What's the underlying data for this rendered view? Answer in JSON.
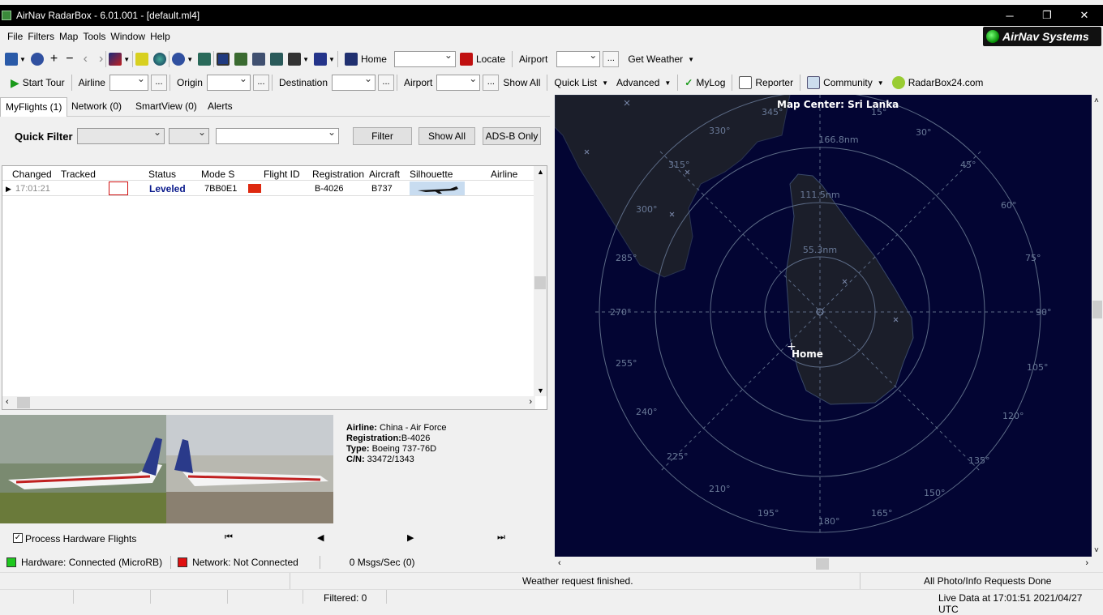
{
  "window": {
    "title": "AirNav RadarBox - 6.01.001 - [default.ml4]",
    "min": "─",
    "max": "❐",
    "close": "✕"
  },
  "menu": [
    "File",
    "Filters",
    "Map",
    "Tools",
    "Window",
    "Help"
  ],
  "brand": "AirNav Systems",
  "toolbar1": {
    "home": "Home",
    "locate": "Locate",
    "airport": "Airport",
    "get_weather": "Get Weather"
  },
  "toolbar2": {
    "start_tour": "Start Tour",
    "airline": "Airline",
    "origin": "Origin",
    "destination": "Destination",
    "airport": "Airport",
    "show_all": "Show All",
    "quick_list": "Quick List",
    "advanced": "Advanced",
    "mylog": "MyLog",
    "reporter": "Reporter",
    "community": "Community",
    "radarbox24": "RadarBox24.com",
    "ellipsis": "..."
  },
  "tabs": [
    "MyFlights (1)",
    "Network (0)",
    "SmartView (0)",
    "Alerts"
  ],
  "quick_filter": {
    "label": "Quick Filter",
    "filter_btn": "Filter",
    "show_all_btn": "Show All",
    "adsb_btn": "ADS-B Only"
  },
  "grid": {
    "columns": [
      "Changed",
      "Tracked",
      "Status",
      "Mode S",
      "Flight ID",
      "Registration",
      "Aircraft",
      "Silhouette",
      "Airline"
    ],
    "rows": [
      {
        "changed": "17:01:21",
        "status": "Leveled",
        "mode_s": "7BB0E1",
        "registration": "B-4026",
        "aircraft": "B737"
      }
    ]
  },
  "aircraft_info": {
    "airline_label": "Airline:",
    "airline": "China - Air Force",
    "registration_label": "Registration:",
    "registration": "B-4026",
    "type_label": "Type:",
    "type": "Boeing 737-76D",
    "cn_label": "C/N:",
    "cn": "33472/1343"
  },
  "nav": {
    "process_hw": "Process Hardware Flights",
    "first": "⏮",
    "prev": "◀",
    "next": "▶",
    "last": "⏭"
  },
  "status": {
    "hardware": "Hardware: Connected (MicroRB)",
    "network": "Network: Not Connected",
    "msgs": "0 Msgs/Sec (0)",
    "weather": "Weather request finished.",
    "photo_done": "All Photo/Info Requests Done",
    "filtered": "Filtered: 0",
    "live": "Live Data at 17:01:51 2021/04/27 UTC"
  },
  "map": {
    "center_label": "Map Center: Sri Lanka",
    "home_label": "Home",
    "ring_labels": [
      "55.3nm",
      "111.5nm",
      "166.8nm"
    ],
    "bearings": [
      "345°",
      "15°",
      "30°",
      "45°",
      "60°",
      "75°",
      "90°",
      "105°",
      "120°",
      "135°",
      "150°",
      "165°",
      "180°",
      "195°",
      "210°",
      "225°",
      "240°",
      "255°",
      "270°",
      "285°",
      "300°",
      "315°",
      "330°"
    ]
  },
  "colors": {
    "map_bg": "#030533",
    "land": "#1b1e2a",
    "ring": "#5c6b86",
    "status_text": "#0a1a8c",
    "led_green": "#1ec81e",
    "led_red": "#e01010"
  }
}
